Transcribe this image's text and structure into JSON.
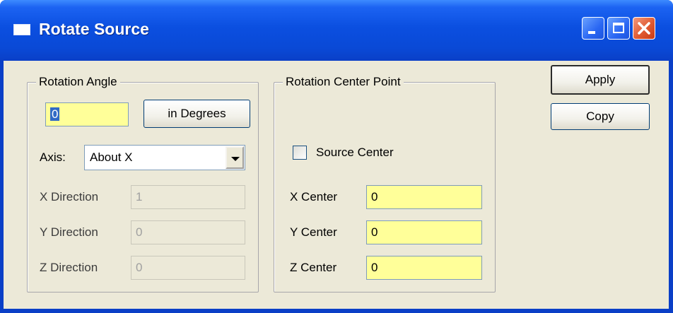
{
  "window": {
    "title": "Rotate Source"
  },
  "rotation_angle": {
    "group_title": "Rotation Angle",
    "angle_value": "0",
    "units_button": "in Degrees",
    "axis_label": "Axis:",
    "axis_value": "About X",
    "x_direction_label": "X Direction",
    "x_direction_value": "1",
    "y_direction_label": "Y Direction",
    "y_direction_value": "0",
    "z_direction_label": "Z Direction",
    "z_direction_value": "0"
  },
  "center_point": {
    "group_title": "Rotation Center Point",
    "source_center_label": "Source Center",
    "source_center_checked": false,
    "x_center_label": "X Center",
    "x_center_value": "0",
    "y_center_label": "Y Center",
    "y_center_value": "0",
    "z_center_label": "Z Center",
    "z_center_value": "0"
  },
  "actions": {
    "apply": "Apply",
    "copy": "Copy"
  },
  "colors": {
    "input_highlight": "#ffff99",
    "title_bar": "#0b4fe0",
    "dialog_face": "#ece9d8"
  }
}
